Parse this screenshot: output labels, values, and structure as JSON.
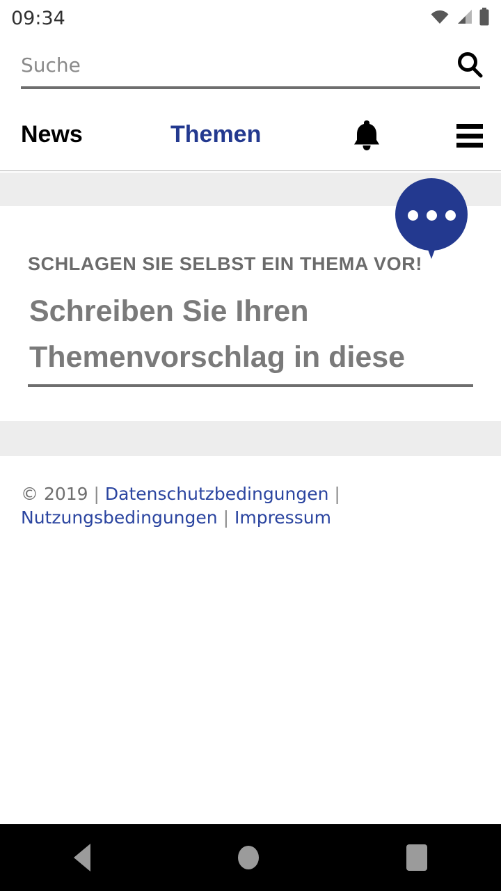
{
  "status_bar": {
    "time": "09:34",
    "icons": [
      "wifi-icon",
      "cellular-signal-icon",
      "battery-icon"
    ]
  },
  "search": {
    "placeholder": "Suche",
    "value": "",
    "icon": "search-icon"
  },
  "main_nav": {
    "items": [
      {
        "label": "News",
        "color": "#000000"
      },
      {
        "label": "Themen",
        "color": "#23398f"
      }
    ],
    "bell_icon": "bell-icon",
    "menu_icon": "hamburger-menu-icon"
  },
  "suggest_card": {
    "bubble_icon": "speech-bubble-ellipsis-icon",
    "kicker": "SCHLAGEN SIE SELBST EIN THEMA VOR!",
    "headline_placeholder": "Schreiben Sie Ihren Themenvorschlag in diese Zeile",
    "headline_value": "Schreiben Sie Ihren Themenvorschlag in diese Zeile"
  },
  "footer": {
    "copyright": "© 2019",
    "separator": "|",
    "links": [
      "Datenschutzbedingungen",
      "Nutzungsbedingungen",
      "Impressum"
    ]
  },
  "android_nav": {
    "back": "back-triangle-icon",
    "home": "home-circle-icon",
    "recents": "recents-square-icon"
  },
  "colors": {
    "brand_blue": "#23398f",
    "link_blue": "#2b45a0",
    "band_gray": "#ededed",
    "text_gray": "#7a7a7a",
    "rule_gray": "#6e6e6e"
  }
}
